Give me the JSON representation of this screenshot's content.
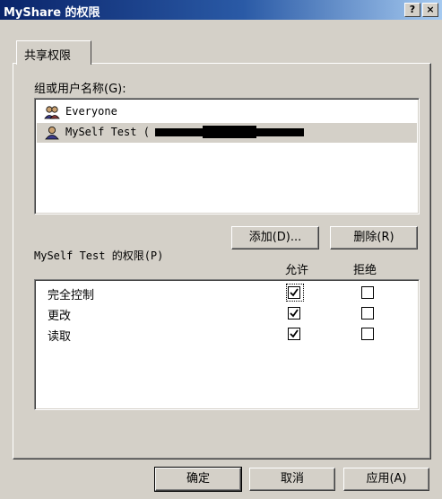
{
  "window": {
    "title": "MyShare 的权限",
    "help_glyph": "?",
    "close_glyph": "×"
  },
  "tabs": [
    {
      "label": "共享权限"
    }
  ],
  "users": {
    "label": "组或用户名称(G):",
    "items": [
      {
        "name": "Everyone",
        "selected": false
      },
      {
        "name": "MySelf Test (",
        "selected": true
      }
    ],
    "add_button": "添加(D)...",
    "remove_button": "删除(R)"
  },
  "permissions": {
    "label": "MySelf Test 的权限(P)",
    "col_allow": "允许",
    "col_deny": "拒绝",
    "rows": [
      {
        "name": "完全控制",
        "allow": true,
        "deny": false
      },
      {
        "name": "更改",
        "allow": true,
        "deny": false
      },
      {
        "name": "读取",
        "allow": true,
        "deny": false
      }
    ]
  },
  "footer": {
    "ok": "确定",
    "cancel": "取消",
    "apply": "应用(A)"
  }
}
